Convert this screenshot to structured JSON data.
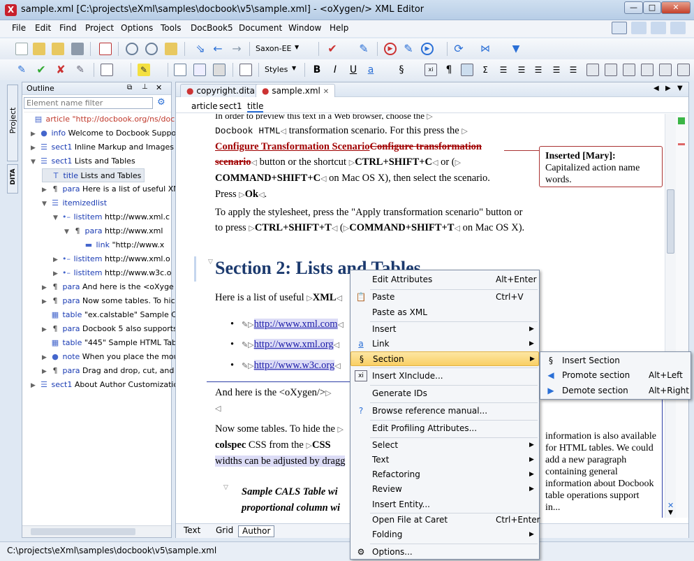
{
  "window": {
    "title": "sample.xml [C:\\projects\\eXml\\samples\\docbook\\v5\\sample.xml] - <oXygen/> XML Editor"
  },
  "menu": [
    "File",
    "Edit",
    "Find",
    "Project",
    "Options",
    "Tools",
    "DocBook5",
    "Document",
    "Window",
    "Help"
  ],
  "toolbar": {
    "transformer": "Saxon-EE",
    "styles_label": "Styles"
  },
  "side_tabs": {
    "project": "Project",
    "dita": "DITA"
  },
  "outline": {
    "title": "Outline",
    "filter_placeholder": "Element name filter",
    "rows": [
      {
        "tag": "article",
        "text": "\"http://docbook.org/ns/docbook",
        "color": "#c0392b"
      },
      {
        "tag": "info",
        "text": "Welcome to Docbook Support"
      },
      {
        "tag": "sect1",
        "text": "Inline Markup and Images"
      },
      {
        "tag": "sect1",
        "text": "Lists and Tables"
      },
      {
        "tag": "title",
        "text": "Lists and Tables"
      },
      {
        "tag": "para",
        "text": "Here is a list of useful XM"
      },
      {
        "tag": "itemizedlist",
        "text": ""
      },
      {
        "tag": "listitem",
        "text": "http://www.xml.c"
      },
      {
        "tag": "para",
        "text": "http://www.xml"
      },
      {
        "tag": "link",
        "text": "\"http://www.x"
      },
      {
        "tag": "listitem",
        "text": "http://www.xml.o"
      },
      {
        "tag": "listitem",
        "text": "http://www.w3c.o"
      },
      {
        "tag": "para",
        "text": "And here is the <oXyge"
      },
      {
        "tag": "para",
        "text": "Now some tables. To hic"
      },
      {
        "tag": "table",
        "text": "\"ex.calstable\" Sample CA"
      },
      {
        "tag": "para",
        "text": "Docbook 5 also supports"
      },
      {
        "tag": "table",
        "text": "\"445\" Sample HTML Table"
      },
      {
        "tag": "note",
        "text": "When you place the mou"
      },
      {
        "tag": "para",
        "text": "Drag and drop, cut, and"
      },
      {
        "tag": "sect1",
        "text": "About Author Customizatio"
      }
    ]
  },
  "editor": {
    "tabs": [
      "copyright.dita",
      "sample.xml"
    ],
    "breadcrumbs": [
      "article",
      "sect1",
      "title"
    ],
    "doc": {
      "top_cut": "In order to preview this text in a Web browser, choose the",
      "docbook_html": "Docbook HTML",
      "transform_intro": "transformation scenario. For this press the",
      "configure_ins": "Configure Transformation Scenario",
      "configure_del": "Configure transformation",
      "scenario_del": "scenario",
      "shortcut_text": "button or the shortcut",
      "ctrl_shift_c": "CTRL+SHIFT+C",
      "or": "or (",
      "cmd_shift_c": "COMMAND+SHIFT+C",
      "mac_select": "on Mac OS X), then select the scenario.",
      "press": "Press",
      "ok": "Ok",
      "apply_text": "To apply the stylesheet, press the \"Apply transformation scenario\" button or to press",
      "ctrl_shift_t": "CTRL+SHIFT+T",
      "cmd_shift_t": "COMMAND+SHIFT+T",
      "on_mac": "on Mac OS X).",
      "section_heading": "Section 2: Lists and Tables",
      "list_intro": "Here is a list of useful",
      "xml": "XML",
      "links": [
        "http://www.xml.com",
        "http://www.xml.org",
        "http://www.w3c.org"
      ],
      "oxygen_text": "And here is the <oXygen/>",
      "tables_text": "Now some tables. To hide the",
      "colspec": "colspec",
      "css_from": "CSS from the",
      "css": "CSS",
      "widths": "widths can be adjusted by dragg",
      "cals_caption_1": "Sample CALS Table wi",
      "cals_caption_2": "proportional column wi"
    },
    "comment1": {
      "label": "Inserted [Mary]:",
      "text": "Capitalized action name words."
    },
    "comment2": {
      "text": "information is also available for HTML tables. We could add a new paragraph containing general information about Docbook table operations support in..."
    },
    "modes": [
      "Text",
      "Grid",
      "Author"
    ],
    "active_mode": "Author"
  },
  "context_menu": {
    "items": [
      {
        "label": "Edit Attributes",
        "shortcut": "Alt+Enter"
      },
      {
        "label": "Paste",
        "shortcut": "Ctrl+V"
      },
      {
        "label": "Paste as XML",
        "shortcut": ""
      },
      {
        "label": "Insert",
        "shortcut": ""
      },
      {
        "label": "Link",
        "shortcut": ""
      },
      {
        "label": "Section",
        "shortcut": ""
      },
      {
        "label": "Insert XInclude...",
        "shortcut": ""
      },
      {
        "label": "Generate IDs",
        "shortcut": ""
      },
      {
        "label": "Browse reference manual...",
        "shortcut": ""
      },
      {
        "label": "Edit Profiling Attributes...",
        "shortcut": ""
      },
      {
        "label": "Select",
        "shortcut": ""
      },
      {
        "label": "Text",
        "shortcut": ""
      },
      {
        "label": "Refactoring",
        "shortcut": ""
      },
      {
        "label": "Review",
        "shortcut": ""
      },
      {
        "label": "Insert Entity...",
        "shortcut": ""
      },
      {
        "label": "Open File at Caret",
        "shortcut": "Ctrl+Enter"
      },
      {
        "label": "Folding",
        "shortcut": ""
      },
      {
        "label": "Options...",
        "shortcut": ""
      }
    ]
  },
  "submenu": {
    "items": [
      {
        "label": "Insert Section",
        "shortcut": ""
      },
      {
        "label": "Promote section",
        "shortcut": "Alt+Left"
      },
      {
        "label": "Demote section",
        "shortcut": "Alt+Right"
      }
    ]
  },
  "status": {
    "path": "C:\\projects\\eXml\\samples\\docbook\\v5\\sample.xml"
  }
}
